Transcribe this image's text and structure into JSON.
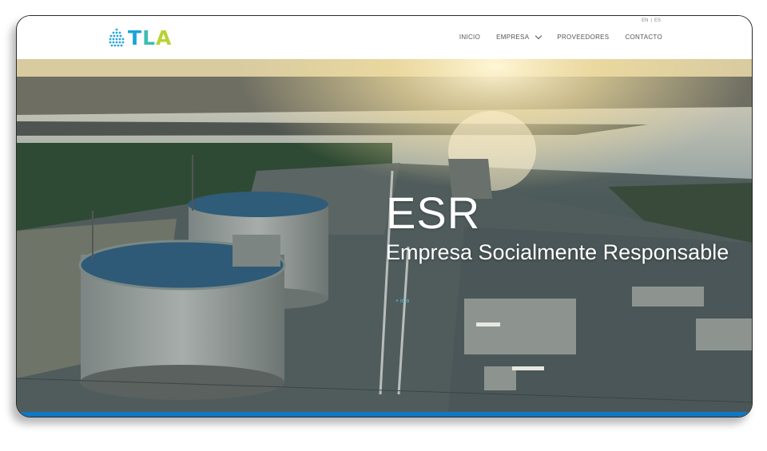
{
  "header": {
    "logo_text": "TLA",
    "languages": [
      "EN",
      "|",
      "ES"
    ],
    "nav": [
      {
        "label": "INICIO"
      },
      {
        "label": "EMPRESA",
        "has_dropdown": true
      },
      {
        "label": "PROVEEDORES"
      },
      {
        "label": "CONTACTO"
      }
    ]
  },
  "hero": {
    "title": "ESR",
    "subtitle": "Empresa Socialmente Responsable",
    "link_text": "+ info"
  },
  "colors": {
    "logo_t": "#1aa3d9",
    "logo_l": "#3bbfb0",
    "logo_a": "#b7d334",
    "accent_bar": "#0e78c2"
  },
  "icons": [
    "logo-mark-icon",
    "chevron-down-icon"
  ]
}
